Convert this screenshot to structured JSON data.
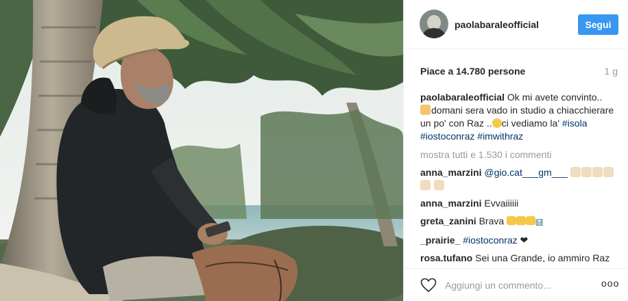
{
  "post": {
    "username": "paolabaraleofficial",
    "follow_label": "Segui",
    "likes_text": "Piace a 14.780 persone",
    "age": "1 g",
    "caption": {
      "user": "paolabaraleofficial",
      "text_1": "Ok mi avete convinto..",
      "text_2": "domani sera vado in studio a chiacchierare un po' con Raz ..",
      "text_3": "ci vediamo la'",
      "tags": [
        "#isola",
        "#iostoconraz",
        "#imwithraz"
      ]
    },
    "show_all_comments": "mostra tutti e 1.530 i commenti",
    "comments": [
      {
        "user": "anna_marzini",
        "mention": "@gio.cat___gm___",
        "text": ""
      },
      {
        "user": "anna_marzini",
        "text": "Evvaiiiiii"
      },
      {
        "user": "greta_zanini",
        "text": "Brava"
      },
      {
        "user": "_prairie_",
        "tag": "#iostoconraz",
        "text": "❤"
      },
      {
        "user": "rosa.tufano",
        "text": "Sei una Grande, io ammiro Raz perché se tante cose interessanti, il"
      }
    ],
    "comment_placeholder": "Aggiungi un commento...",
    "more_options": "ooo"
  },
  "icons": {
    "avatar": "profile-avatar",
    "like": "heart-outline-icon",
    "options": "ellipsis-icon"
  },
  "colors": {
    "accent": "#3897f0",
    "tag": "#003569",
    "muted": "#999999",
    "text": "#262626"
  }
}
